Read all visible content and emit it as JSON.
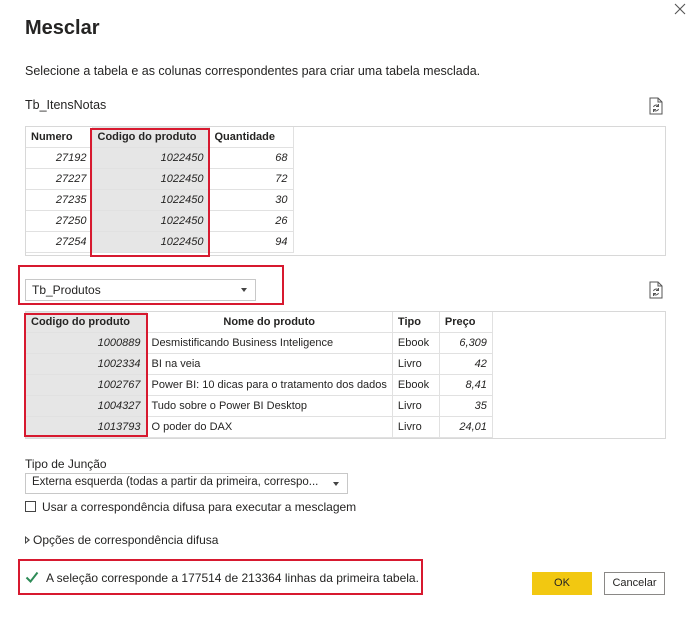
{
  "dialog": {
    "title": "Mesclar",
    "subtitle": "Selecione a tabela e as colunas correspondentes para criar uma tabela mesclada."
  },
  "first_table": {
    "name": "Tb_ItensNotas",
    "columns": [
      "Numero",
      "Codigo do produto",
      "Quantidade"
    ],
    "selected_column": "Codigo do produto",
    "rows": [
      [
        "27192",
        "1022450",
        "68"
      ],
      [
        "27227",
        "1022450",
        "72"
      ],
      [
        "27235",
        "1022450",
        "30"
      ],
      [
        "27250",
        "1022450",
        "26"
      ],
      [
        "27254",
        "1022450",
        "94"
      ]
    ]
  },
  "second_table": {
    "selected_table": "Tb_Produtos",
    "columns": [
      "Codigo do produto",
      "Nome do produto",
      "Tipo",
      "Preço"
    ],
    "selected_column": "Codigo do produto",
    "rows": [
      [
        "1000889",
        "Desmistificando Business Inteligence",
        "Ebook",
        "6,309"
      ],
      [
        "1002334",
        "BI na veia",
        "Livro",
        "42"
      ],
      [
        "1002767",
        "Power BI: 10 dicas para o tratamento dos dados",
        "Ebook",
        "8,41"
      ],
      [
        "1004327",
        "Tudo sobre o Power BI Desktop",
        "Livro",
        "35"
      ],
      [
        "1013793",
        "O poder do DAX",
        "Livro",
        "24,01"
      ]
    ]
  },
  "join": {
    "label": "Tipo de Junção",
    "selected": "Externa esquerda (todas a partir da primeira, correspo..."
  },
  "fuzzy": {
    "checkbox_label": "Usar a correspondência difusa para executar a mesclagem",
    "checked": false,
    "options_label": "Opções de correspondência difusa"
  },
  "status": {
    "message": "A seleção corresponde a 177514 de 213364 linhas da primeira tabela."
  },
  "buttons": {
    "ok": "OK",
    "cancel": "Cancelar"
  },
  "colors": {
    "accent": "#f2c811",
    "highlight_border": "#d7192f",
    "success": "#2e8b57"
  },
  "icons": {
    "close": "close-icon",
    "refresh": "refresh-icon",
    "check": "check-icon",
    "expander": "chevron-right-icon"
  }
}
